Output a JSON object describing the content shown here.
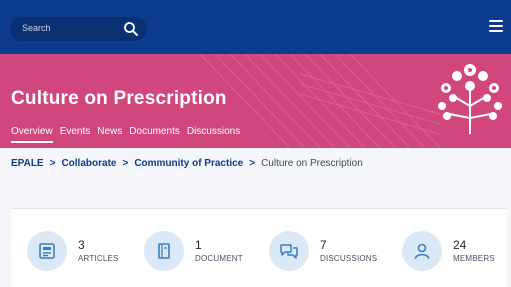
{
  "search": {
    "placeholder": "Search"
  },
  "hero": {
    "title": "Culture on Prescription",
    "tabs": [
      {
        "label": "Overview",
        "active": true
      },
      {
        "label": "Events"
      },
      {
        "label": "News"
      },
      {
        "label": "Documents"
      },
      {
        "label": "Discussions"
      }
    ]
  },
  "breadcrumb": {
    "items": [
      "EPALE",
      "Collaborate",
      "Community of Practice",
      "Culture on Prescription"
    ],
    "separator": ">"
  },
  "stats": [
    {
      "count": "3",
      "label": "ARTICLES",
      "icon": "articles-icon"
    },
    {
      "count": "1",
      "label": "DOCUMENT",
      "icon": "document-icon"
    },
    {
      "count": "7",
      "label": "DISCUSSIONS",
      "icon": "discussions-icon"
    },
    {
      "count": "24",
      "label": "MEMBERS",
      "icon": "members-icon"
    }
  ],
  "colors": {
    "nav": "#0d3b8e",
    "hero": "#d1467d",
    "icon_bg": "#dbe8f6",
    "icon_stroke": "#3a7cc4"
  }
}
